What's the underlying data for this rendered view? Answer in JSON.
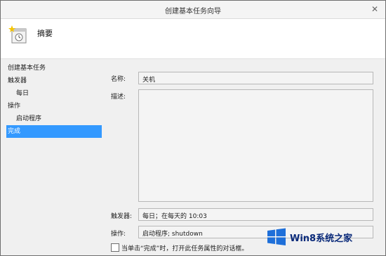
{
  "window": {
    "title": "创建基本任务向导",
    "close_label": "✕"
  },
  "header": {
    "title": "摘要"
  },
  "nav": {
    "items": [
      {
        "label": "创建基本任务",
        "indent": false,
        "active": false
      },
      {
        "label": "触发器",
        "indent": false,
        "active": false
      },
      {
        "label": "每日",
        "indent": true,
        "active": false
      },
      {
        "label": "操作",
        "indent": false,
        "active": false
      },
      {
        "label": "启动程序",
        "indent": true,
        "active": false
      },
      {
        "label": "完成",
        "indent": false,
        "active": true
      }
    ]
  },
  "summary": {
    "name_label": "名称:",
    "name_value": "关机",
    "description_label": "描述:",
    "description_value": "",
    "trigger_label": "触发器:",
    "trigger_value": "每日；在每天的 10:03",
    "action_label": "操作:",
    "action_value": "启动程序; shutdown"
  },
  "checkbox": {
    "label": "当单击“完成”时，打开此任务属性的对话框。",
    "checked": false
  },
  "watermark": {
    "text": "Win8系统之家"
  },
  "colors": {
    "selection": "#3399ff",
    "watermark": "#0a2a7a"
  }
}
